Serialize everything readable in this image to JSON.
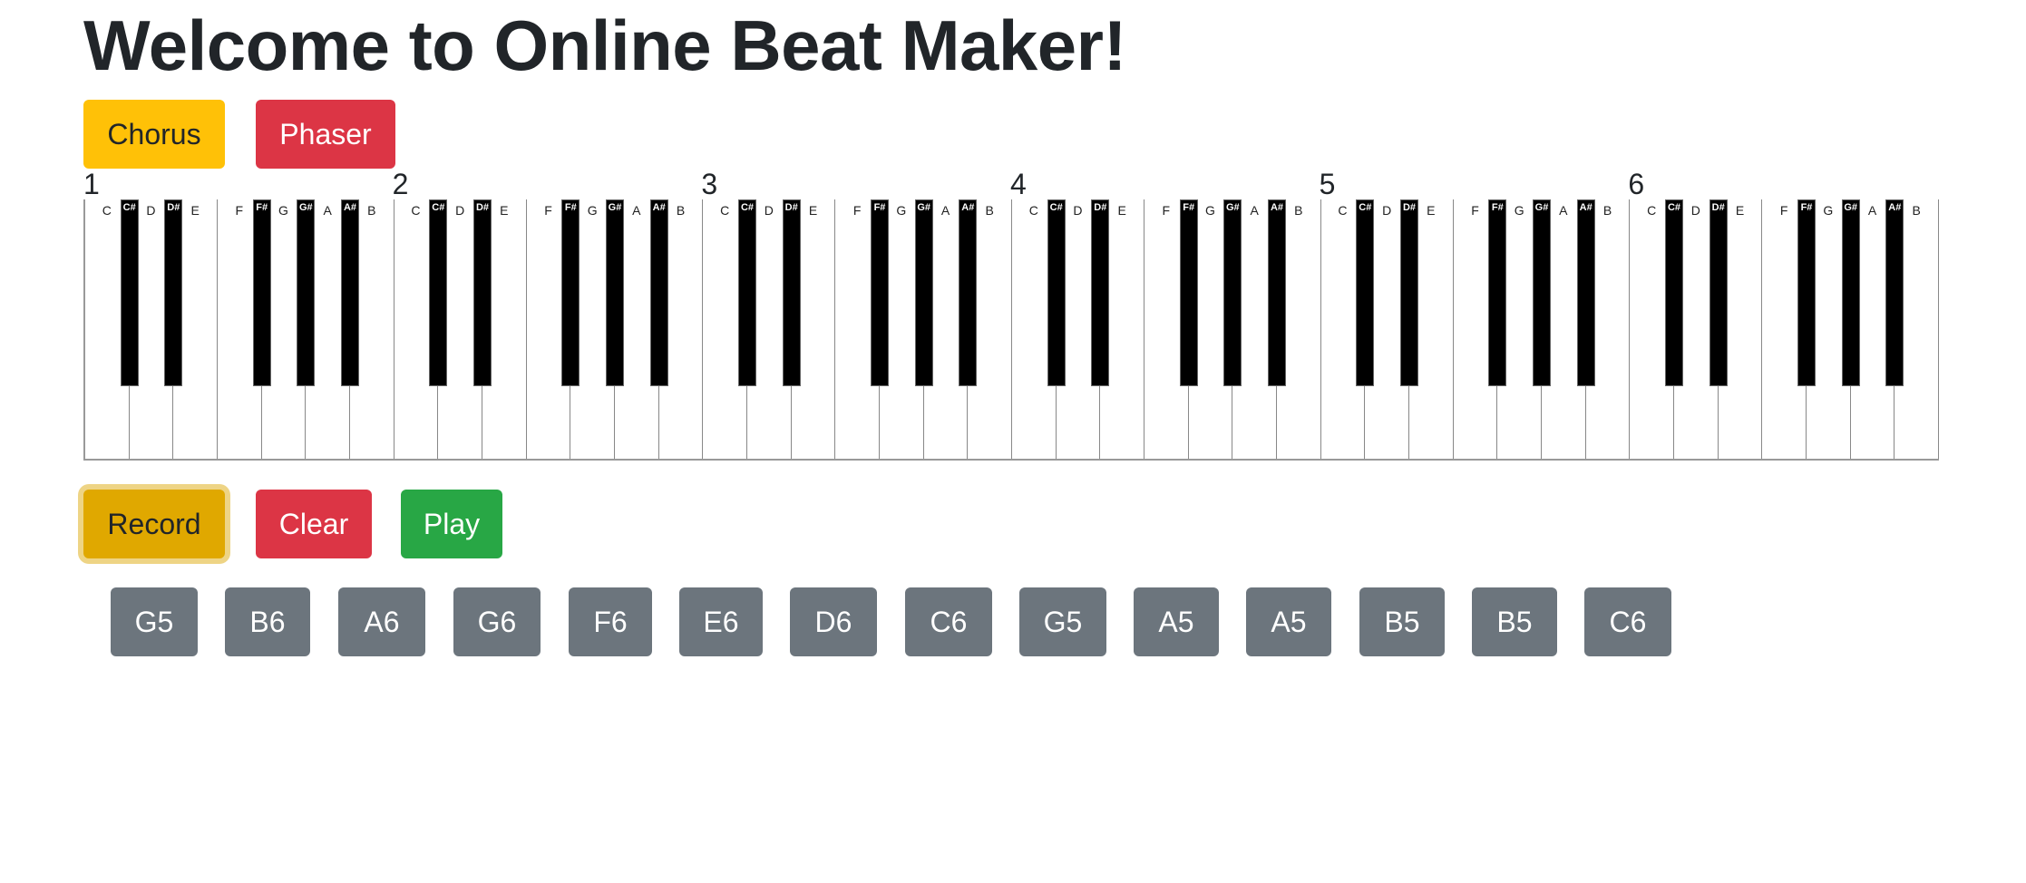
{
  "title": "Welcome to Online Beat Maker!",
  "effects": {
    "chorus_label": "Chorus",
    "phaser_label": "Phaser"
  },
  "piano": {
    "octaves": [
      "1",
      "2",
      "3",
      "4",
      "5",
      "6"
    ],
    "white_notes": [
      "C",
      "D",
      "E",
      "F",
      "G",
      "A",
      "B"
    ],
    "black_notes": [
      "C#",
      "D#",
      "F#",
      "G#",
      "A#"
    ]
  },
  "controls": {
    "record_label": "Record",
    "clear_label": "Clear",
    "play_label": "Play"
  },
  "recorded_notes": [
    "G5",
    "B6",
    "A6",
    "G6",
    "F6",
    "E6",
    "D6",
    "C6",
    "G5",
    "A5",
    "A5",
    "B5",
    "B5",
    "C6"
  ],
  "colors": {
    "warning": "#ffc107",
    "danger": "#dc3545",
    "success": "#28a745",
    "secondary": "#6c757d",
    "text": "#212529"
  }
}
